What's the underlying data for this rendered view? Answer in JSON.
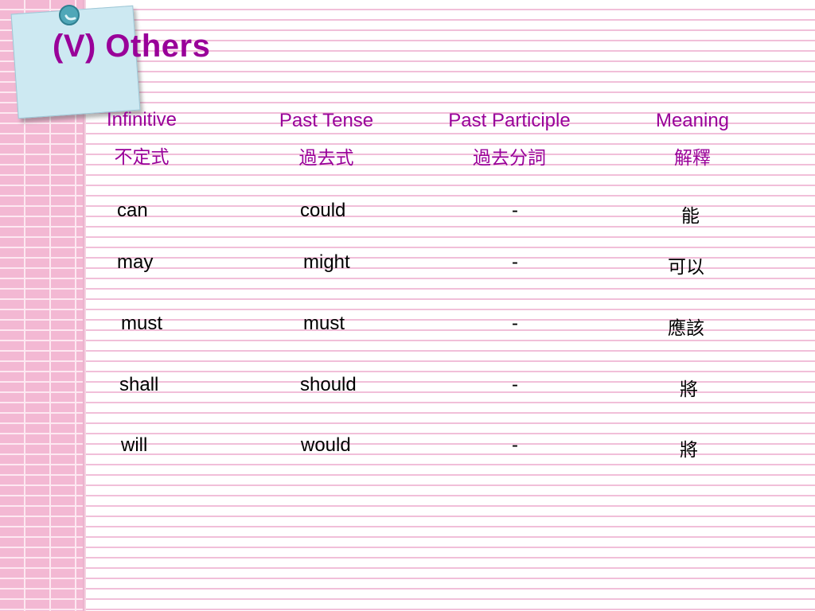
{
  "title": "(V) Others",
  "colors": {
    "title": "#990099",
    "body_text": "#000000",
    "ruled_lines": "#f1bfd9",
    "brick": "#f3b8d3",
    "note": "#cde9f2"
  },
  "decorations": {
    "pin_icon": "push-pin-icon"
  },
  "table": {
    "headers": [
      {
        "en": "Infinitive",
        "zh": "不定式"
      },
      {
        "en": "Past Tense",
        "zh": "過去式"
      },
      {
        "en": "Past Participle",
        "zh": "過去分詞"
      },
      {
        "en": "Meaning",
        "zh": "解釋"
      }
    ],
    "rows": [
      {
        "infinitive": "can",
        "past_tense": "could",
        "past_participle": "-",
        "meaning": "能"
      },
      {
        "infinitive": "may",
        "past_tense": "might",
        "past_participle": "-",
        "meaning": "可以"
      },
      {
        "infinitive": "must",
        "past_tense": "must",
        "past_participle": "-",
        "meaning": "應該"
      },
      {
        "infinitive": "shall",
        "past_tense": "should",
        "past_participle": "-",
        "meaning": "將"
      },
      {
        "infinitive": "will",
        "past_tense": "would",
        "past_participle": "-",
        "meaning": "將"
      }
    ]
  }
}
